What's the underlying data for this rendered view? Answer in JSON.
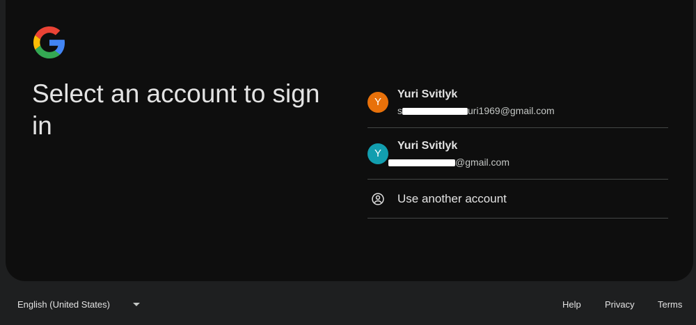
{
  "heading": "Select an account to sign in",
  "accounts": [
    {
      "initial": "Y",
      "name": "Yuri Svitlyk",
      "email_prefix": "s",
      "email_visible": "uri1969@gmail.com",
      "avatar_color": "#e8710a"
    },
    {
      "initial": "Y",
      "name": "Yuri Svitlyk",
      "email_prefix": "",
      "email_visible": "@gmail.com",
      "avatar_color": "#129eaf"
    }
  ],
  "use_another": {
    "label": "Use another account",
    "icon": "account-circle-icon"
  },
  "footer": {
    "language": "English (United States)",
    "links": [
      "Help",
      "Privacy",
      "Terms"
    ]
  },
  "colors": {
    "background": "#1e1f20",
    "card": "#0e0e0e",
    "divider": "#444746",
    "text": "#e3e3e3"
  }
}
